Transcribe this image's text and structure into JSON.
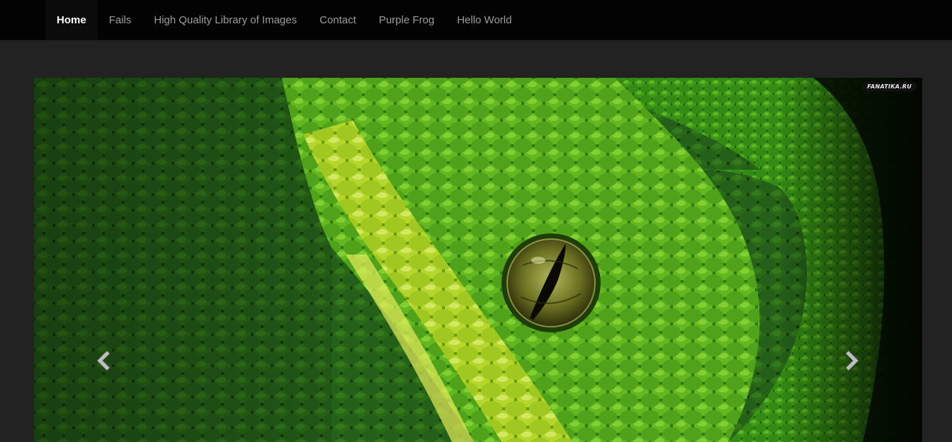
{
  "navbar": {
    "items": [
      {
        "label": "Home",
        "active": true
      },
      {
        "label": "Fails",
        "active": false
      },
      {
        "label": "High Quality Library of Images",
        "active": false
      },
      {
        "label": "Contact",
        "active": false
      },
      {
        "label": "Purple Frog",
        "active": false
      },
      {
        "label": "Hello World",
        "active": false
      }
    ]
  },
  "carousel": {
    "image_subject": "green snake scales eye",
    "watermark": "FANATIKA.RU",
    "prev_icon": "chevron-left-icon",
    "next_icon": "chevron-right-icon"
  },
  "colors": {
    "navbar_bg": "#030303",
    "page_bg": "#222222",
    "active_text": "#ffffff",
    "nav_text": "#9d9d9d"
  }
}
